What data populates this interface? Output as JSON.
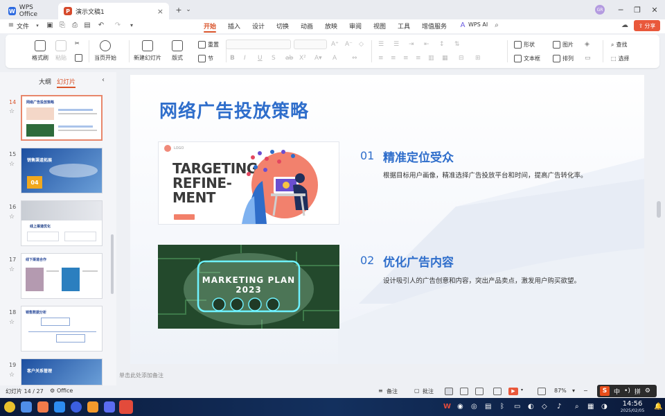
{
  "titlebar": {
    "tabs": [
      {
        "label": "WPS Office",
        "icon": "wps-logo-icon"
      },
      {
        "label": "演示文稿1",
        "icon": "presentation-doc-icon"
      }
    ],
    "close_tab": "×",
    "new_tab": "+",
    "tab_list": "⌄",
    "user_avatar": "GR",
    "controls": [
      "─",
      "❐",
      "✕"
    ]
  },
  "menubar": {
    "file_label": "文件",
    "tabs": [
      "开始",
      "插入",
      "设计",
      "切换",
      "动画",
      "放映",
      "审阅",
      "视图",
      "工具",
      "增值服务"
    ],
    "active_tab": "开始",
    "ai_label": "WPS AI",
    "share_label": "分享"
  },
  "ribbon": {
    "format_painter": "格式刷",
    "paste": "粘贴",
    "start_from_current": "当页开始",
    "new_slide": "新建幻灯片",
    "layout": "版式",
    "reset": "重置",
    "section": "节",
    "shape": "形状",
    "picture": "图片",
    "textbox": "文本框",
    "arrange": "排列",
    "find": "查找",
    "select": "选择"
  },
  "sidebar": {
    "tabs": [
      "大纲",
      "幻灯片"
    ],
    "active_tab": "幻灯片",
    "slides": [
      {
        "num": "14",
        "title": "网络广告投放策略",
        "current": true
      },
      {
        "num": "15",
        "title": "销售渠道拓展",
        "badge": "04"
      },
      {
        "num": "16",
        "title": "线上渠道优化"
      },
      {
        "num": "17",
        "title": "线下渠道合作"
      },
      {
        "num": "18",
        "title": "销售数据分析"
      },
      {
        "num": "19",
        "title": "客户关系管理"
      }
    ]
  },
  "slide": {
    "title": "网络广告投放策略",
    "image1": {
      "headline_lines": [
        "TARGETING",
        "REFINE-",
        "MENT"
      ],
      "logo": "LOGO"
    },
    "image2": {
      "headline_lines": [
        "MARKETING PLAN",
        "2023"
      ]
    },
    "sections": [
      {
        "num": "01",
        "title": "精准定位受众",
        "body": "根据目标用户画像，精准选择广告投放平台和时间，提高广告转化率。"
      },
      {
        "num": "02",
        "title": "优化广告内容",
        "body": "设计吸引人的广告创意和内容，突出产品卖点，激发用户购买欲望。"
      }
    ]
  },
  "notes_placeholder": "单击此处添加备注",
  "statusbar": {
    "slide_counter": "幻灯片 14 / 27",
    "theme": "Office",
    "notes": "备注",
    "comments": "批注",
    "zoom": "87%"
  },
  "ime": {
    "brand": "S",
    "labels": [
      "中",
      "•)",
      "拼"
    ]
  },
  "taskbar": {
    "time": "14:56",
    "date": "2025/02/05"
  },
  "colors": {
    "accent": "#d9542b",
    "title_blue": "#2f6ecb",
    "share": "#e9583b"
  }
}
